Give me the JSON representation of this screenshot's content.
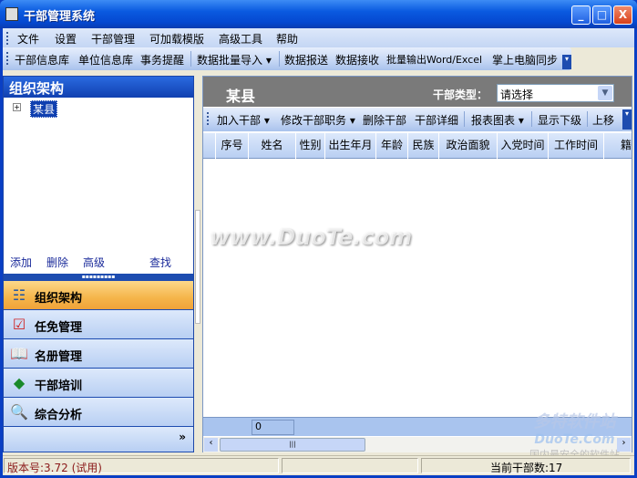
{
  "window": {
    "title": "干部管理系统",
    "minimize": "_",
    "maximize": "□",
    "close": "X"
  },
  "menu": [
    "文件",
    "设置",
    "干部管理",
    "可加载模版",
    "高级工具",
    "帮助"
  ],
  "toolbar": {
    "items": [
      "干部信息库",
      "单位信息库",
      "事务提醒",
      "数据批量导入 ▾",
      "数据报送",
      "数据接收",
      "批量输出Word/Excel",
      "掌上电脑同步"
    ],
    "overflow": "▾"
  },
  "left": {
    "header": "组织架构",
    "tree": [
      {
        "label": "某县",
        "expand": "⊞",
        "selected": true
      }
    ],
    "links": [
      "添加",
      "删除",
      "高级",
      "查找"
    ],
    "nav": [
      {
        "label": "组织架构",
        "icon": "org-tree-icon",
        "selected": true
      },
      {
        "label": "任免管理",
        "icon": "appointment-icon"
      },
      {
        "label": "名册管理",
        "icon": "roster-book-icon"
      },
      {
        "label": "干部培训",
        "icon": "training-book-icon"
      },
      {
        "label": "综合分析",
        "icon": "magnifier-icon"
      }
    ],
    "more": "»"
  },
  "right": {
    "title": "某县",
    "type_label": "干部类型：",
    "type_value": "请选择",
    "toolbar": [
      "加入干部 ▾",
      "修改干部职务 ▾",
      "删除干部",
      "干部详细",
      "报表图表 ▾",
      "显示下级",
      "上移"
    ],
    "columns": [
      "序号",
      "姓名",
      "性别",
      "出生年月",
      "年龄",
      "民族",
      "政治面貌",
      "入党时间",
      "工作时间",
      "籍"
    ],
    "footer_value": "0"
  },
  "status": {
    "version": "版本号:3.72 (试用)",
    "count": "当前干部数:17"
  },
  "watermark": {
    "main": "www.DuoTe.com",
    "logo": "多特软件站",
    "logo_sub": "DuoTe.Com",
    "logo_tag": "国内最安全的软件站"
  },
  "colors": {
    "title_blue": "#0a5ae0",
    "selected_nav": "#f5b54a",
    "header_gray": "#7a7a7a"
  }
}
